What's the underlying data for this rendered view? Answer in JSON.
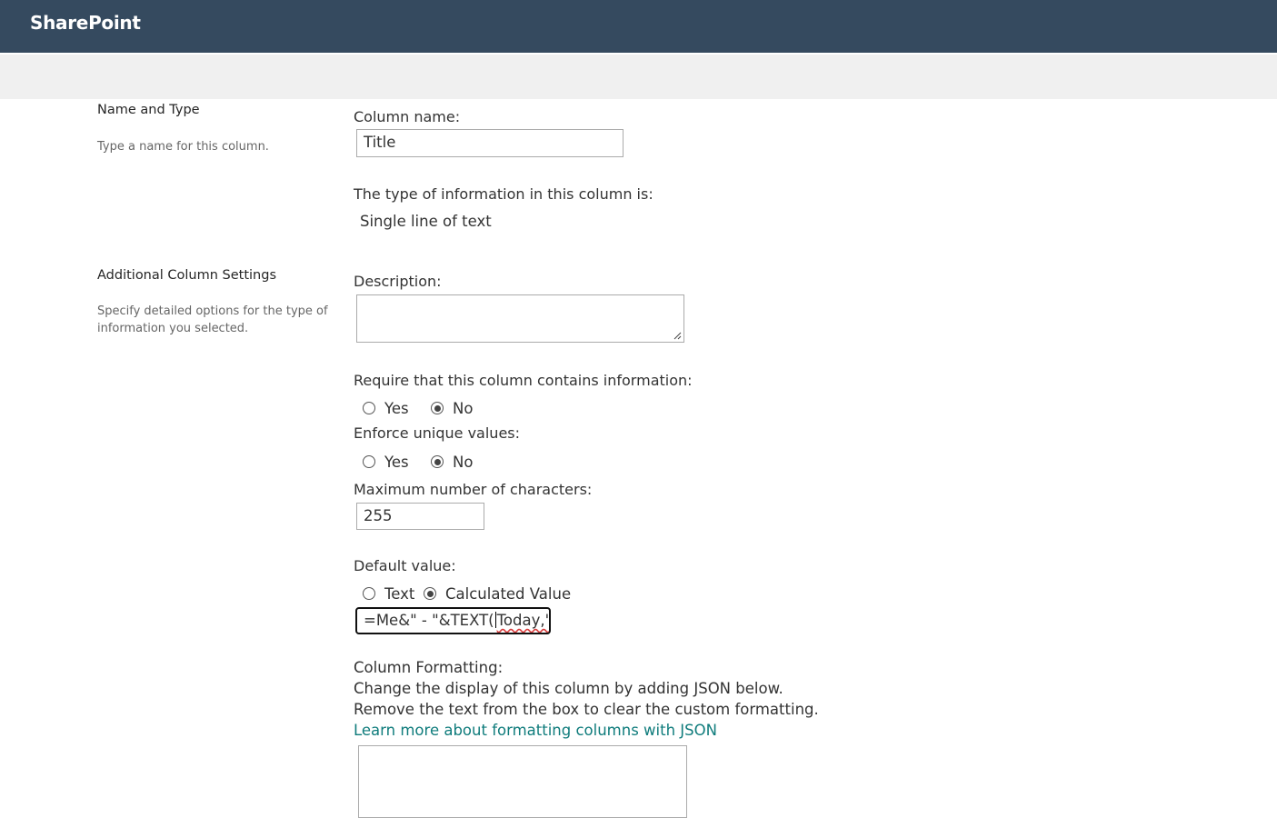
{
  "header": {
    "brand": "SharePoint"
  },
  "sections": {
    "name_type": {
      "title": "Name and Type",
      "description": "Type a name for this column."
    },
    "additional": {
      "title": "Additional Column Settings",
      "description": "Specify detailed options for the type of information you selected."
    }
  },
  "fields": {
    "column_name": {
      "label": "Column name:",
      "value": "Title"
    },
    "type": {
      "label": "The type of information in this column is:",
      "value": "Single line of text"
    },
    "description": {
      "label": "Description:",
      "value": ""
    },
    "require": {
      "label": "Require that this column contains information:",
      "yes": "Yes",
      "no": "No",
      "selected": "No"
    },
    "unique": {
      "label": "Enforce unique values:",
      "yes": "Yes",
      "no": "No",
      "selected": "No"
    },
    "max_chars": {
      "label": "Maximum number of characters:",
      "value": "255"
    },
    "default_value": {
      "label": "Default value:",
      "option_text": "Text",
      "option_calc": "Calculated Value",
      "selected": "Calculated Value",
      "formula_before_caret": "=Me&\" - \"&TEXT(",
      "formula_after_caret": "Today,\"d"
    },
    "formatting": {
      "label": "Column Formatting:",
      "line1": "Change the display of this column by adding JSON below.",
      "line2": "Remove the text from the box to clear the custom formatting.",
      "link": "Learn more about formatting columns with JSON",
      "value": ""
    }
  }
}
